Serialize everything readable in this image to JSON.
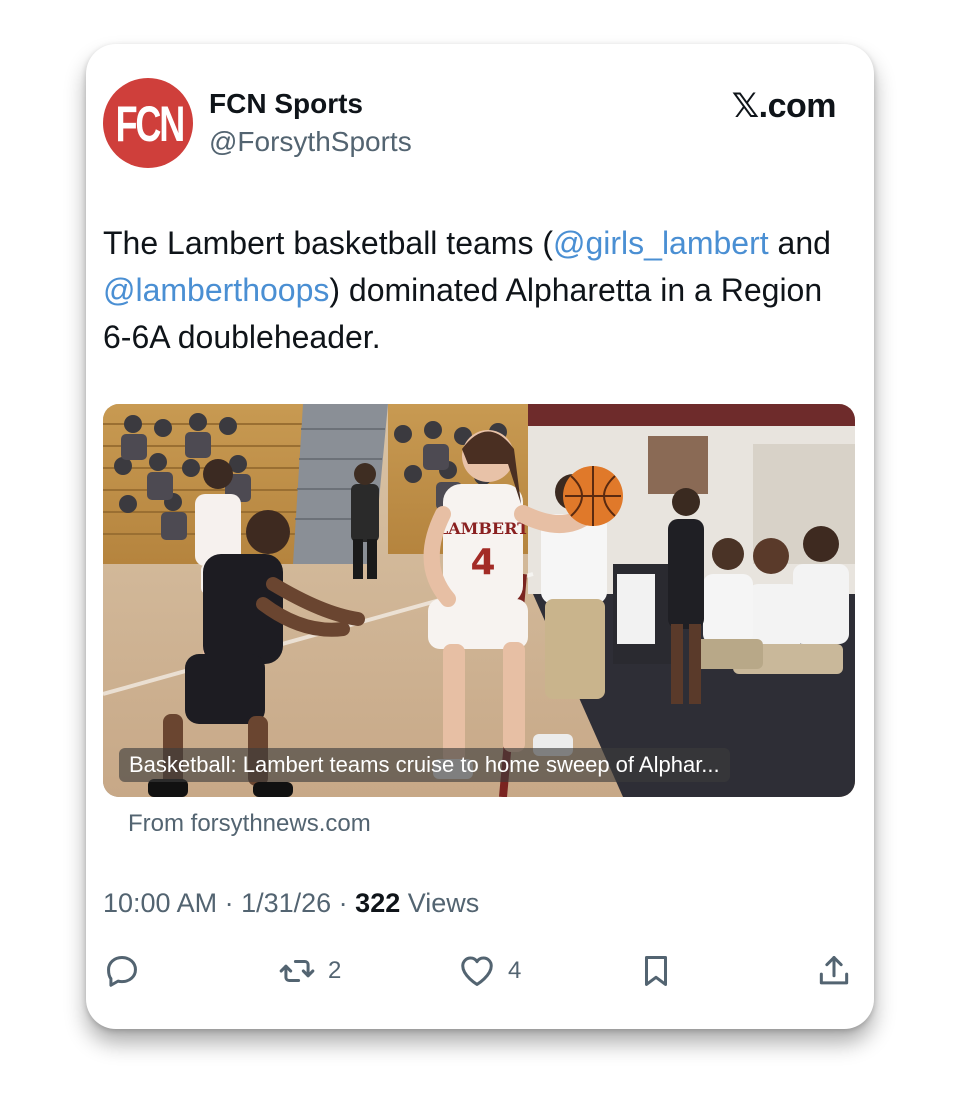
{
  "account": {
    "avatar_text": "FCN",
    "display_name": "FCN Sports",
    "handle": "@ForsythSports",
    "avatar_color": "#cf3f3b"
  },
  "platform": {
    "glyph": "𝕏",
    "label": ".com"
  },
  "tweet": {
    "text_1": "The Lambert basketball teams (",
    "mention_1": "@girls_lambert",
    "text_2": " and ",
    "mention_2": "@lamberthoops",
    "text_3": ") dominated Alpharetta in a Region 6-6A doubleheader.",
    "mention_color": "#4a8fd3"
  },
  "link_card": {
    "caption": "Basketball: Lambert teams cruise to home sweep of Alphar...",
    "source": "From forsythnews.com"
  },
  "meta": {
    "time": "10:00 AM",
    "sep_1": " · ",
    "date": "1/31/26",
    "sep_2": " · ",
    "views_count": "322",
    "views_label": " Views"
  },
  "actions": {
    "reply": {
      "icon": "reply-icon"
    },
    "repost": {
      "icon": "repost-icon",
      "count": "2"
    },
    "like": {
      "icon": "heart-icon",
      "count": "4"
    },
    "bookmark": {
      "icon": "bookmark-icon"
    },
    "share": {
      "icon": "share-icon"
    }
  }
}
